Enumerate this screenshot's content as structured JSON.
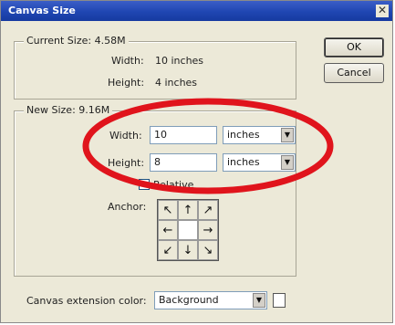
{
  "window": {
    "title": "Canvas Size",
    "close_symbol": "✕"
  },
  "buttons": {
    "ok": "OK",
    "cancel": "Cancel"
  },
  "current_size": {
    "legend": "Current Size: 4.58M",
    "width_label": "Width:",
    "width_value": "10 inches",
    "height_label": "Height:",
    "height_value": "4 inches"
  },
  "new_size": {
    "legend": "New Size: 9.16M",
    "width_label": "Width:",
    "width_value": "10",
    "width_unit": "inches",
    "height_label": "Height:",
    "height_value": "8",
    "height_unit": "inches",
    "relative_label": "Relative",
    "relative_checked": false,
    "anchor_label": "Anchor:"
  },
  "anchor": {
    "cells": [
      "↖",
      "↑",
      "↗",
      "←",
      "",
      "→",
      "↙",
      "↓",
      "↘"
    ]
  },
  "extension": {
    "label": "Canvas extension color:",
    "value": "Background"
  },
  "icons": {
    "dropdown_arrow": "▼"
  },
  "colors": {
    "highlight_ring": "#e0141c",
    "title_bar": "#1f46b2",
    "dialog_bg": "#ece9d8"
  }
}
